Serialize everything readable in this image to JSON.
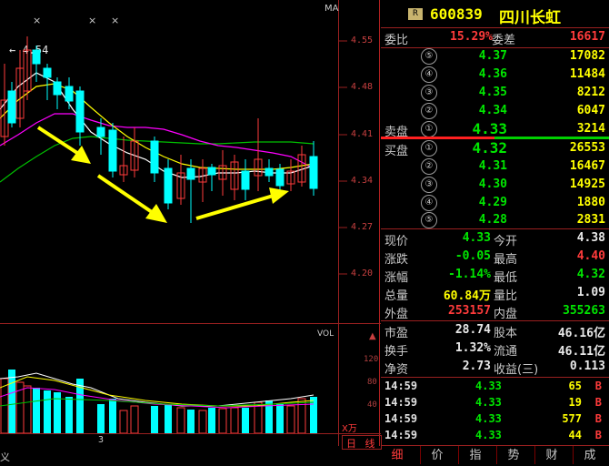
{
  "chart": {
    "ma_label": "MA",
    "markers": [
      "×",
      "×",
      "×"
    ],
    "price_ticks": [
      "4.55",
      "4.48",
      "4.41",
      "4.34",
      "4.27",
      "4.20"
    ],
    "high_label": "4.54",
    "vol_label": "VOL",
    "vol_ticks": [
      "120",
      "80",
      "40"
    ],
    "vol_unit": "X万",
    "bottom_left": "义",
    "bottom_mid": "3",
    "bottom_tabs": [
      "日",
      "线"
    ]
  },
  "quote_header": {
    "badge": "R",
    "code": "600839",
    "name": "四川长虹"
  },
  "weibi": {
    "label1": "委比",
    "value1": "15.29%",
    "label2": "委差",
    "value2": "16617"
  },
  "sell_orders": [
    {
      "level": "⑤",
      "price": "4.37",
      "volume": "17082"
    },
    {
      "level": "④",
      "price": "4.36",
      "volume": "11484"
    },
    {
      "level": "③",
      "price": "4.35",
      "volume": "8212"
    },
    {
      "level": "②",
      "price": "4.34",
      "volume": "6047"
    },
    {
      "level": "①",
      "price": "4.33",
      "volume": "3214",
      "label": "卖盘"
    }
  ],
  "buy_orders": [
    {
      "level": "①",
      "price": "4.32",
      "volume": "26553",
      "label": "买盘"
    },
    {
      "level": "②",
      "price": "4.31",
      "volume": "16467"
    },
    {
      "level": "③",
      "price": "4.30",
      "volume": "14925"
    },
    {
      "level": "④",
      "price": "4.29",
      "volume": "1880"
    },
    {
      "level": "⑤",
      "price": "4.28",
      "volume": "2831"
    }
  ],
  "stats": [
    {
      "l1": "现价",
      "v1": "4.33",
      "c1": "green",
      "l2": "今开",
      "v2": "4.38",
      "c2": "white"
    },
    {
      "l1": "涨跌",
      "v1": "-0.05",
      "c1": "green",
      "l2": "最高",
      "v2": "4.40",
      "c2": "red"
    },
    {
      "l1": "涨幅",
      "v1": "-1.14%",
      "c1": "green",
      "l2": "最低",
      "v2": "4.32",
      "c2": "green"
    },
    {
      "l1": "总量",
      "v1": "60.84万",
      "c1": "yellow",
      "l2": "量比",
      "v2": "1.09",
      "c2": "white"
    },
    {
      "l1": "外盘",
      "v1": "253157",
      "c1": "red",
      "l2": "内盘",
      "v2": "355263",
      "c2": "green"
    }
  ],
  "fundamentals": [
    {
      "l1": "市盈",
      "v1": "28.74",
      "l2": "股本",
      "v2": "46.16亿"
    },
    {
      "l1": "换手",
      "v1": "1.32%",
      "l2": "流通",
      "v2": "46.11亿"
    },
    {
      "l1": "净资",
      "v1": "2.73",
      "l2": "收益(三)",
      "v2": "0.113"
    }
  ],
  "ticks": [
    {
      "time": "14:59",
      "price": "4.33",
      "vol": "65",
      "side": "B"
    },
    {
      "time": "14:59",
      "price": "4.33",
      "vol": "19",
      "side": "B"
    },
    {
      "time": "14:59",
      "price": "4.33",
      "vol": "577",
      "side": "B"
    },
    {
      "time": "14:59",
      "price": "4.33",
      "vol": "44",
      "side": "B"
    }
  ],
  "tabs": [
    "细",
    "价",
    "指",
    "势",
    "财",
    "成"
  ],
  "colors": {
    "up": "#ff3b3b",
    "down": "#00ffff",
    "grid": "#7a0000",
    "ma5": "#ffffff",
    "ma10": "#ffff00",
    "ma20": "#ff00ff",
    "ma30": "#00c000"
  }
}
